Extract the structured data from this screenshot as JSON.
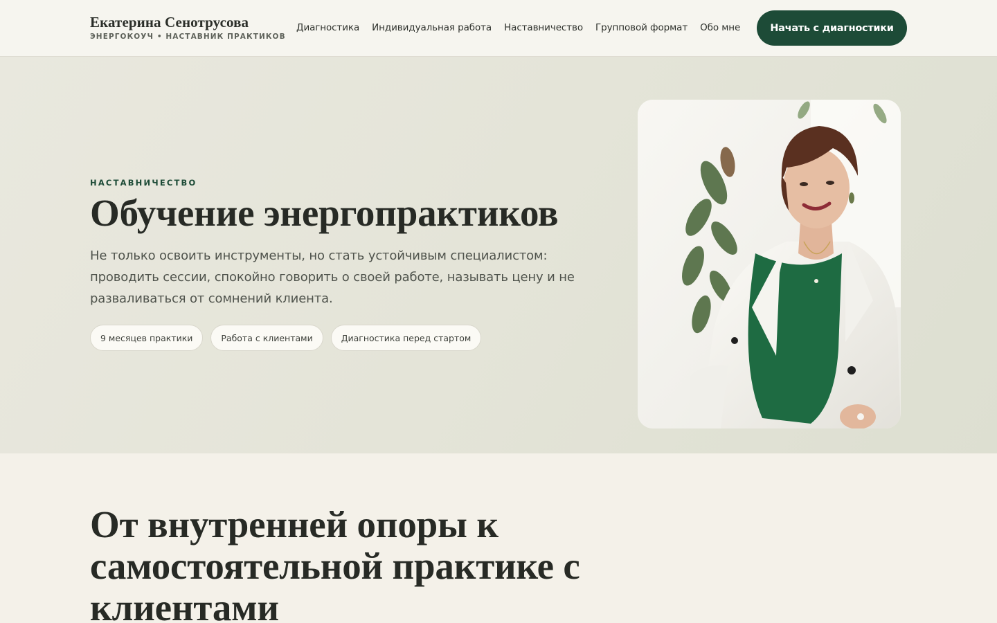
{
  "header": {
    "brand_name": "Екатерина Сенотрусова",
    "brand_sub": "ЭНЕРГОКОУЧ • НАСТАВНИК ПРАКТИКОВ",
    "nav": [
      {
        "label": "Диагностика"
      },
      {
        "label": "Индивидуальная работа"
      },
      {
        "label": "Наставничество"
      },
      {
        "label": "Групповой формат"
      },
      {
        "label": "Обо мне"
      }
    ],
    "cta_label": "Начать с диагностики"
  },
  "hero": {
    "eyebrow": "НАСТАВНИЧЕСТВО",
    "title": "Обучение энергопрактиков",
    "text": "Не только освоить инструменты, но стать устойчивым специалистом: проводить сессии, спокойно говорить о своей работе, называть цену и не разваливаться от сомнений клиента.",
    "chips": [
      {
        "label": "9 месяцев практики"
      },
      {
        "label": "Работа с клиентами"
      },
      {
        "label": "Диагностика перед стартом"
      }
    ]
  },
  "section": {
    "title": "От внутренней опоры к самостоятельной практике с клиентами"
  },
  "colors": {
    "accent": "#1d4b37",
    "hero_bg": "#e4e4d8",
    "page_bg": "#f4f1e9",
    "text_dark": "#272a25"
  }
}
